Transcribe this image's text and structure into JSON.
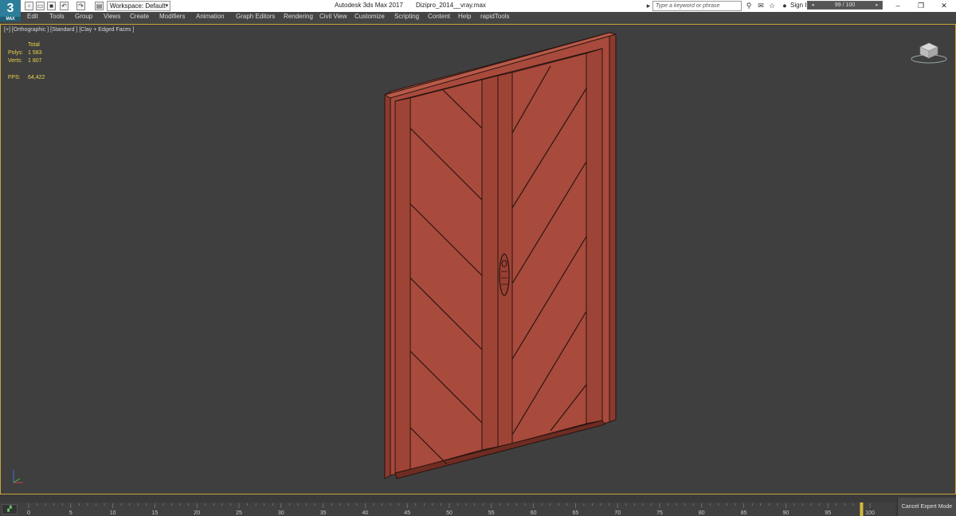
{
  "titlebar": {
    "logo_text": "3",
    "logo_sub": "MAX",
    "workspace_label": "Workspace: Default",
    "app_title": "Autodesk 3ds Max 2017",
    "file_name": "Dizipro_2014__vray.max",
    "search_placeholder": "Type a keyword or phrase",
    "sign_in": "Sign In"
  },
  "menu": {
    "items": [
      "Edit",
      "Tools",
      "Group",
      "Views",
      "Create",
      "Modifiers",
      "Animation",
      "Graph Editors",
      "Rendering",
      "Civil View",
      "Customize",
      "Scripting",
      "Content",
      "Help",
      "rapidTools"
    ]
  },
  "viewport": {
    "label": "[+] [Orthographic ] [Standard ] [Clay + Edged Faces ]",
    "stats": {
      "total_label": "Total",
      "polys_label": "Polys:",
      "polys_value": "1 583",
      "verts_label": "Verts:",
      "verts_value": "1 807",
      "fps_label": "FPS:",
      "fps_value": "64,422"
    },
    "colors": {
      "model_fill": "#a84a3c",
      "model_edge": "#2a1410",
      "stats_text": "#e8d44a",
      "border_active": "#c9a33a"
    }
  },
  "timeline": {
    "slider_text": "99 / 100",
    "current_frame": 99,
    "total_frames": 100,
    "ticks": [
      "0",
      "5",
      "10",
      "15",
      "20",
      "25",
      "30",
      "35",
      "40",
      "45",
      "50",
      "55",
      "60",
      "65",
      "70",
      "75",
      "80",
      "85",
      "90",
      "95",
      "100"
    ]
  },
  "status": {
    "cancel_expert": "Cancel Expert Mode"
  }
}
